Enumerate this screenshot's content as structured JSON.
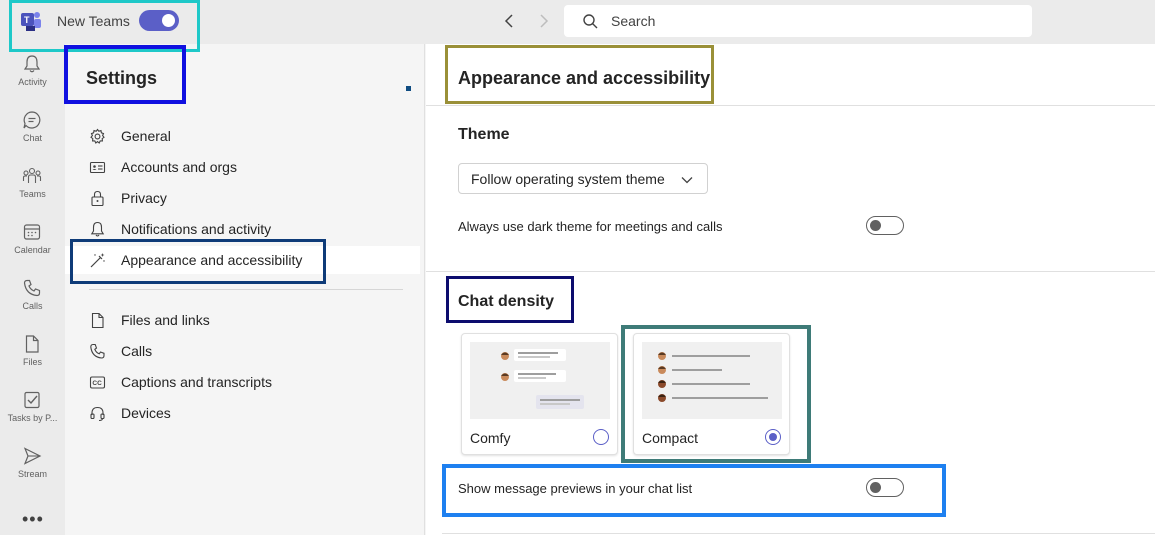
{
  "titlebar": {
    "new_teams_label": "New Teams",
    "search_placeholder": "Search",
    "new_teams_enabled": true
  },
  "rail": [
    {
      "label": "Activity",
      "icon": "bell-icon"
    },
    {
      "label": "Chat",
      "icon": "chat-icon"
    },
    {
      "label": "Teams",
      "icon": "teams-icon"
    },
    {
      "label": "Calendar",
      "icon": "calendar-icon"
    },
    {
      "label": "Calls",
      "icon": "phone-icon"
    },
    {
      "label": "Files",
      "icon": "file-icon"
    },
    {
      "label": "Tasks by P...",
      "icon": "tasks-icon"
    },
    {
      "label": "Stream",
      "icon": "stream-icon"
    }
  ],
  "rail_more": "•••",
  "settings": {
    "title": "Settings",
    "items": [
      {
        "label": "General",
        "icon": "gear-icon"
      },
      {
        "label": "Accounts and orgs",
        "icon": "id-card-icon"
      },
      {
        "label": "Privacy",
        "icon": "lock-icon"
      },
      {
        "label": "Notifications and activity",
        "icon": "bell-icon"
      },
      {
        "label": "Appearance and accessibility",
        "icon": "magic-wand-icon",
        "selected": true
      },
      {
        "label": "Files and links",
        "icon": "file-icon"
      },
      {
        "label": "Calls",
        "icon": "phone-icon"
      },
      {
        "label": "Captions and transcripts",
        "icon": "cc-icon"
      },
      {
        "label": "Devices",
        "icon": "headset-icon"
      }
    ]
  },
  "content": {
    "title": "Appearance and accessibility",
    "theme": {
      "heading": "Theme",
      "selected": "Follow operating system theme",
      "dark_meetings_label": "Always use dark theme for meetings and calls",
      "dark_meetings_enabled": false
    },
    "chat_density": {
      "heading": "Chat density",
      "options": [
        {
          "label": "Comfy",
          "selected": false
        },
        {
          "label": "Compact",
          "selected": true
        }
      ],
      "previews_label": "Show message previews in your chat list",
      "previews_enabled": false
    }
  },
  "colors": {
    "accent": "#5b5fc7",
    "highlight_cyan": "#1ec8c8",
    "highlight_blue": "#1010e0",
    "highlight_navy": "#0e3b78",
    "highlight_olive": "#9a9038",
    "highlight_darknavy": "#0c0c6e",
    "highlight_teal": "#3e7b78",
    "highlight_sky": "#1e80f0"
  }
}
